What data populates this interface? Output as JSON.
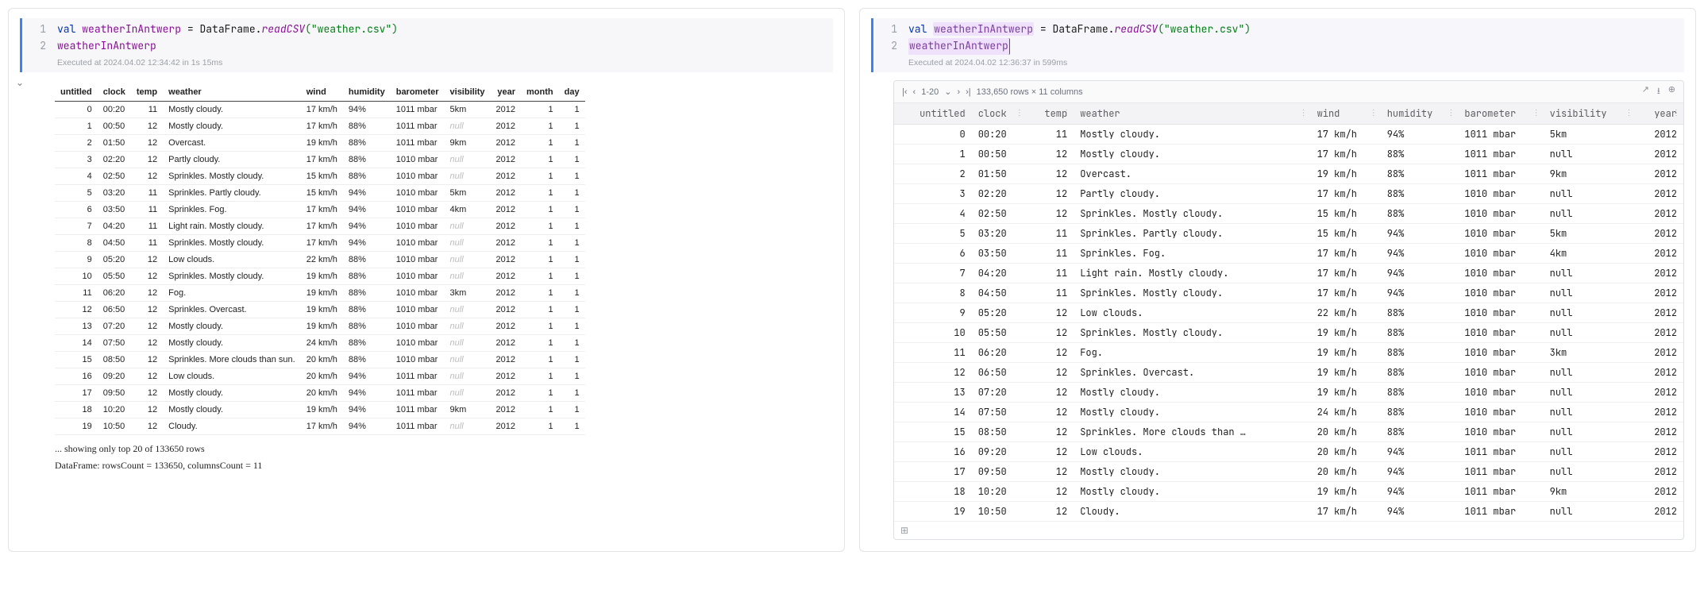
{
  "left": {
    "code": {
      "l1_kw": "val",
      "l1_var": "weatherInAntwerp",
      "l1_eq": " = ",
      "l1_cls": "DataFrame.",
      "l1_fn": "readCSV",
      "l1_arg": "(\"weather.csv\")",
      "l2": "weatherInAntwerp"
    },
    "executed": "Executed at 2024.04.02 12:34:42 in 1s 15ms",
    "headers": [
      "untitled",
      "clock",
      "temp",
      "weather",
      "wind",
      "humidity",
      "barometer",
      "visibility",
      "year",
      "month",
      "day"
    ],
    "rows": [
      [
        "0",
        "00:20",
        "11",
        "Mostly cloudy.",
        "17 km/h",
        "94%",
        "1011 mbar",
        "5km",
        "2012",
        "1",
        "1"
      ],
      [
        "1",
        "00:50",
        "12",
        "Mostly cloudy.",
        "17 km/h",
        "88%",
        "1011 mbar",
        "null",
        "2012",
        "1",
        "1"
      ],
      [
        "2",
        "01:50",
        "12",
        "Overcast.",
        "19 km/h",
        "88%",
        "1011 mbar",
        "9km",
        "2012",
        "1",
        "1"
      ],
      [
        "3",
        "02:20",
        "12",
        "Partly cloudy.",
        "17 km/h",
        "88%",
        "1010 mbar",
        "null",
        "2012",
        "1",
        "1"
      ],
      [
        "4",
        "02:50",
        "12",
        "Sprinkles. Mostly cloudy.",
        "15 km/h",
        "88%",
        "1010 mbar",
        "null",
        "2012",
        "1",
        "1"
      ],
      [
        "5",
        "03:20",
        "11",
        "Sprinkles. Partly cloudy.",
        "15 km/h",
        "94%",
        "1010 mbar",
        "5km",
        "2012",
        "1",
        "1"
      ],
      [
        "6",
        "03:50",
        "11",
        "Sprinkles. Fog.",
        "17 km/h",
        "94%",
        "1010 mbar",
        "4km",
        "2012",
        "1",
        "1"
      ],
      [
        "7",
        "04:20",
        "11",
        "Light rain. Mostly cloudy.",
        "17 km/h",
        "94%",
        "1010 mbar",
        "null",
        "2012",
        "1",
        "1"
      ],
      [
        "8",
        "04:50",
        "11",
        "Sprinkles. Mostly cloudy.",
        "17 km/h",
        "94%",
        "1010 mbar",
        "null",
        "2012",
        "1",
        "1"
      ],
      [
        "9",
        "05:20",
        "12",
        "Low clouds.",
        "22 km/h",
        "88%",
        "1010 mbar",
        "null",
        "2012",
        "1",
        "1"
      ],
      [
        "10",
        "05:50",
        "12",
        "Sprinkles. Mostly cloudy.",
        "19 km/h",
        "88%",
        "1010 mbar",
        "null",
        "2012",
        "1",
        "1"
      ],
      [
        "11",
        "06:20",
        "12",
        "Fog.",
        "19 km/h",
        "88%",
        "1010 mbar",
        "3km",
        "2012",
        "1",
        "1"
      ],
      [
        "12",
        "06:50",
        "12",
        "Sprinkles. Overcast.",
        "19 km/h",
        "88%",
        "1010 mbar",
        "null",
        "2012",
        "1",
        "1"
      ],
      [
        "13",
        "07:20",
        "12",
        "Mostly cloudy.",
        "19 km/h",
        "88%",
        "1010 mbar",
        "null",
        "2012",
        "1",
        "1"
      ],
      [
        "14",
        "07:50",
        "12",
        "Mostly cloudy.",
        "24 km/h",
        "88%",
        "1010 mbar",
        "null",
        "2012",
        "1",
        "1"
      ],
      [
        "15",
        "08:50",
        "12",
        "Sprinkles. More clouds than sun.",
        "20 km/h",
        "88%",
        "1010 mbar",
        "null",
        "2012",
        "1",
        "1"
      ],
      [
        "16",
        "09:20",
        "12",
        "Low clouds.",
        "20 km/h",
        "94%",
        "1011 mbar",
        "null",
        "2012",
        "1",
        "1"
      ],
      [
        "17",
        "09:50",
        "12",
        "Mostly cloudy.",
        "20 km/h",
        "94%",
        "1011 mbar",
        "null",
        "2012",
        "1",
        "1"
      ],
      [
        "18",
        "10:20",
        "12",
        "Mostly cloudy.",
        "19 km/h",
        "94%",
        "1011 mbar",
        "9km",
        "2012",
        "1",
        "1"
      ],
      [
        "19",
        "10:50",
        "12",
        "Cloudy.",
        "17 km/h",
        "94%",
        "1011 mbar",
        "null",
        "2012",
        "1",
        "1"
      ]
    ],
    "showing": "... showing only top 20 of 133650 rows",
    "summary": "DataFrame: rowsCount = 133650, columnsCount = 11"
  },
  "right": {
    "code": {
      "l1_kw": "val",
      "l1_var": "weatherInAntwerp",
      "l1_eq": " = ",
      "l1_cls": "DataFrame.",
      "l1_fn": "readCSV",
      "l1_arg": "(\"weather.csv\")",
      "l2": "weatherInAntwerp"
    },
    "executed": "Executed at 2024.04.02 12:36:37 in 599ms",
    "pager": {
      "range": "1-20",
      "info": "133,650 rows × 11 columns"
    },
    "headers": [
      "untitled",
      "clock",
      "temp",
      "weather",
      "wind",
      "humidity",
      "barometer",
      "visibility",
      "year"
    ],
    "rows": [
      [
        "0",
        "00:20",
        "11",
        "Mostly cloudy.",
        "17 km/h",
        "94%",
        "1011 mbar",
        "5km",
        "2012"
      ],
      [
        "1",
        "00:50",
        "12",
        "Mostly cloudy.",
        "17 km/h",
        "88%",
        "1011 mbar",
        "null",
        "2012"
      ],
      [
        "2",
        "01:50",
        "12",
        "Overcast.",
        "19 km/h",
        "88%",
        "1011 mbar",
        "9km",
        "2012"
      ],
      [
        "3",
        "02:20",
        "12",
        "Partly cloudy.",
        "17 km/h",
        "88%",
        "1010 mbar",
        "null",
        "2012"
      ],
      [
        "4",
        "02:50",
        "12",
        "Sprinkles. Mostly cloudy.",
        "15 km/h",
        "88%",
        "1010 mbar",
        "null",
        "2012"
      ],
      [
        "5",
        "03:20",
        "11",
        "Sprinkles. Partly cloudy.",
        "15 km/h",
        "94%",
        "1010 mbar",
        "5km",
        "2012"
      ],
      [
        "6",
        "03:50",
        "11",
        "Sprinkles. Fog.",
        "17 km/h",
        "94%",
        "1010 mbar",
        "4km",
        "2012"
      ],
      [
        "7",
        "04:20",
        "11",
        "Light rain. Mostly cloudy.",
        "17 km/h",
        "94%",
        "1010 mbar",
        "null",
        "2012"
      ],
      [
        "8",
        "04:50",
        "11",
        "Sprinkles. Mostly cloudy.",
        "17 km/h",
        "94%",
        "1010 mbar",
        "null",
        "2012"
      ],
      [
        "9",
        "05:20",
        "12",
        "Low clouds.",
        "22 km/h",
        "88%",
        "1010 mbar",
        "null",
        "2012"
      ],
      [
        "10",
        "05:50",
        "12",
        "Sprinkles. Mostly cloudy.",
        "19 km/h",
        "88%",
        "1010 mbar",
        "null",
        "2012"
      ],
      [
        "11",
        "06:20",
        "12",
        "Fog.",
        "19 km/h",
        "88%",
        "1010 mbar",
        "3km",
        "2012"
      ],
      [
        "12",
        "06:50",
        "12",
        "Sprinkles. Overcast.",
        "19 km/h",
        "88%",
        "1010 mbar",
        "null",
        "2012"
      ],
      [
        "13",
        "07:20",
        "12",
        "Mostly cloudy.",
        "19 km/h",
        "88%",
        "1010 mbar",
        "null",
        "2012"
      ],
      [
        "14",
        "07:50",
        "12",
        "Mostly cloudy.",
        "24 km/h",
        "88%",
        "1010 mbar",
        "null",
        "2012"
      ],
      [
        "15",
        "08:50",
        "12",
        "Sprinkles. More clouds than …",
        "20 km/h",
        "88%",
        "1010 mbar",
        "null",
        "2012"
      ],
      [
        "16",
        "09:20",
        "12",
        "Low clouds.",
        "20 km/h",
        "94%",
        "1011 mbar",
        "null",
        "2012"
      ],
      [
        "17",
        "09:50",
        "12",
        "Mostly cloudy.",
        "20 km/h",
        "94%",
        "1011 mbar",
        "null",
        "2012"
      ],
      [
        "18",
        "10:20",
        "12",
        "Mostly cloudy.",
        "19 km/h",
        "94%",
        "1011 mbar",
        "9km",
        "2012"
      ],
      [
        "19",
        "10:50",
        "12",
        "Cloudy.",
        "17 km/h",
        "94%",
        "1011 mbar",
        "null",
        "2012"
      ]
    ]
  }
}
